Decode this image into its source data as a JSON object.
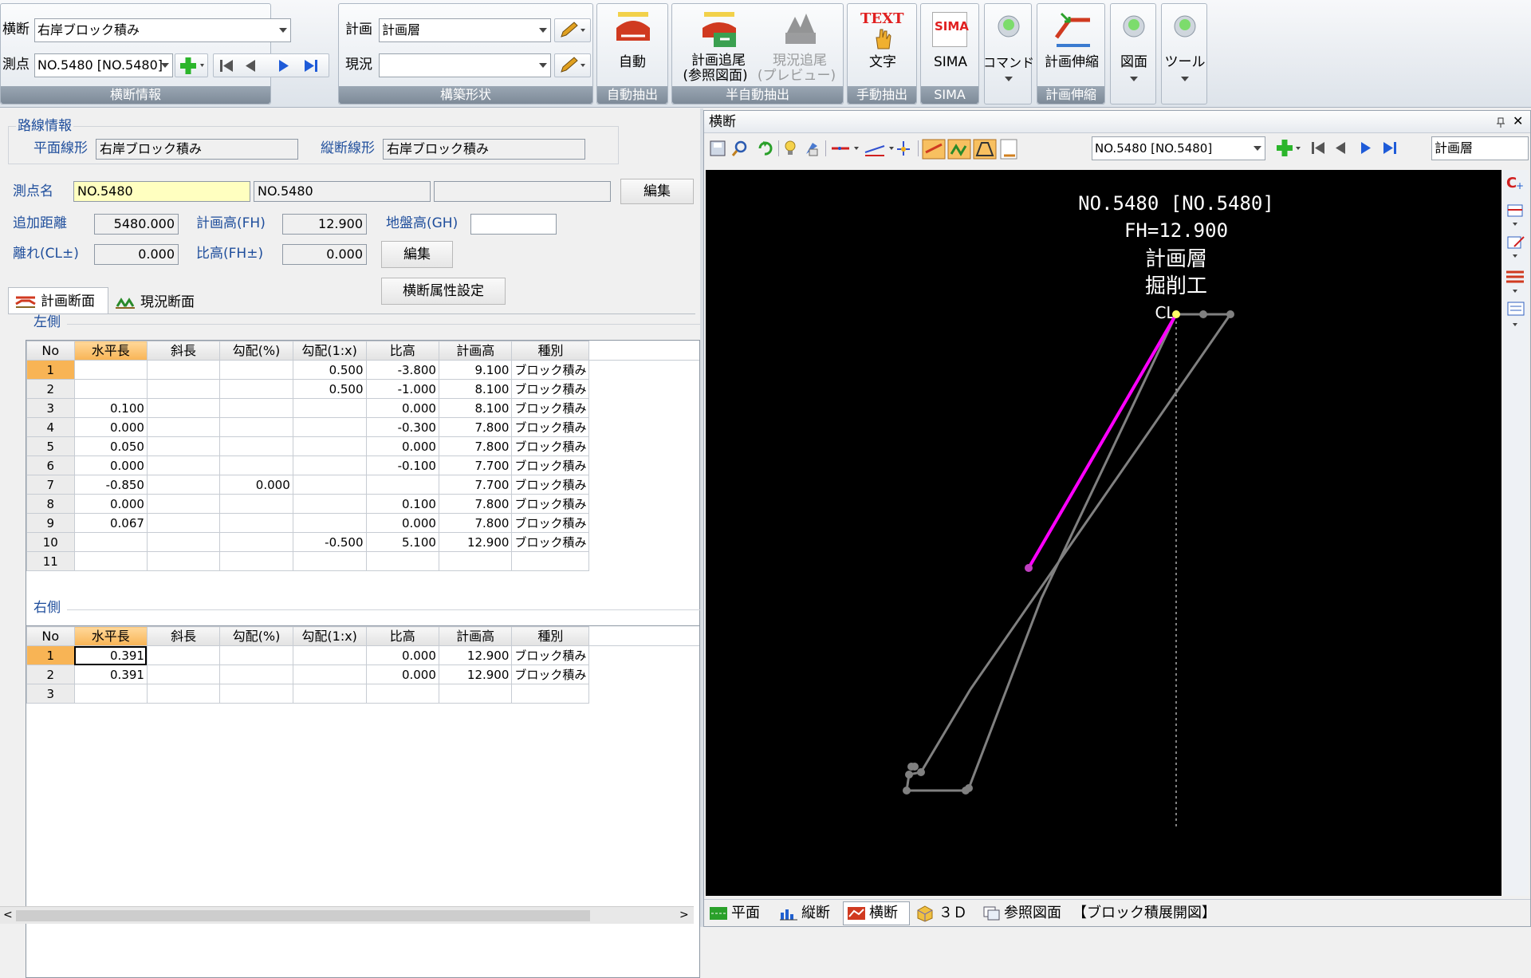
{
  "ribbon": {
    "oudan_label": "横断",
    "oudan_value": "右岸ブロック積み",
    "sokuten_label": "測点",
    "sokuten_value": "NO.5480 [NO.5480]",
    "group1_caption": "横断情報",
    "keikaku_label": "計画",
    "keikaku_value": "計画層",
    "genkyo_label": "現況",
    "genkyo_value": "",
    "group2_caption": "構築形状",
    "auto_label": "自動",
    "group3_caption": "自動抽出",
    "keikaku_tsuibi_line1": "計画追尾",
    "keikaku_tsuibi_line2": "(参照図面)",
    "genkyo_tsuibi_line1": "現況追尾",
    "genkyo_tsuibi_line2": "(プレビュー)",
    "group4_caption": "半自動抽出",
    "text_icon_word": "TEXT",
    "moji_label": "文字",
    "group5_caption": "手動抽出",
    "sima_icon_word": "SIMA",
    "sima_label": "SIMA",
    "group6_caption": "SIMA",
    "command_label": "コマンド",
    "keikaku_shinshuku_label": "計画伸縮",
    "group7_caption": "計画伸縮",
    "zumen_label": "図面",
    "tool_label": "ツール"
  },
  "left": {
    "rosen_title": "路線情報",
    "heimen_label": "平面線形",
    "heimen_value": "右岸ブロック積み",
    "jyudan_label": "縦断線形",
    "jyudan_value": "右岸ブロック積み",
    "sokuten_name_label": "測点名",
    "sokuten_name_value": "NO.5480",
    "sokuten_name_value2": "NO.5480",
    "sokuten_name_value3": "",
    "edit_label": "編集",
    "tsuika_label": "追加距離",
    "tsuika_value": "5480.000",
    "keikakudaka_label": "計画高(FH)",
    "keikakudaka_value": "12.900",
    "jibandaka_label": "地盤高(GH)",
    "jibandaka_value": "",
    "hanare_label": "離れ(CL±)",
    "hanare_value": "0.000",
    "hikou_label": "比高(FH±)",
    "hikou_value": "0.000",
    "edit2_label": "編集",
    "zokusei_label": "横断属性設定",
    "tab_keikaku": "計画断面",
    "tab_genkyo": "現況断面",
    "left_side_title": "左側",
    "right_side_title": "右側",
    "columns": [
      "No",
      "水平長",
      "斜長",
      "勾配(%)",
      "勾配(1:x)",
      "比高",
      "計画高",
      "種別"
    ],
    "left_rows": [
      {
        "no": "1",
        "h": "",
        "s": "",
        "p": "",
        "x": "0.500",
        "hk": "-3.800",
        "fh": "9.100",
        "type": "ブロック積み"
      },
      {
        "no": "2",
        "h": "",
        "s": "",
        "p": "",
        "x": "0.500",
        "hk": "-1.000",
        "fh": "8.100",
        "type": "ブロック積み"
      },
      {
        "no": "3",
        "h": "0.100",
        "s": "",
        "p": "",
        "x": "",
        "hk": "0.000",
        "fh": "8.100",
        "type": "ブロック積み"
      },
      {
        "no": "4",
        "h": "0.000",
        "s": "",
        "p": "",
        "x": "",
        "hk": "-0.300",
        "fh": "7.800",
        "type": "ブロック積み"
      },
      {
        "no": "5",
        "h": "0.050",
        "s": "",
        "p": "",
        "x": "",
        "hk": "0.000",
        "fh": "7.800",
        "type": "ブロック積み"
      },
      {
        "no": "6",
        "h": "0.000",
        "s": "",
        "p": "",
        "x": "",
        "hk": "-0.100",
        "fh": "7.700",
        "type": "ブロック積み"
      },
      {
        "no": "7",
        "h": "-0.850",
        "s": "",
        "p": "0.000",
        "x": "",
        "hk": "",
        "fh": "7.700",
        "type": "ブロック積み"
      },
      {
        "no": "8",
        "h": "0.000",
        "s": "",
        "p": "",
        "x": "",
        "hk": "0.100",
        "fh": "7.800",
        "type": "ブロック積み"
      },
      {
        "no": "9",
        "h": "0.067",
        "s": "",
        "p": "",
        "x": "",
        "hk": "0.000",
        "fh": "7.800",
        "type": "ブロック積み"
      },
      {
        "no": "10",
        "h": "",
        "s": "",
        "p": "",
        "x": "-0.500",
        "hk": "5.100",
        "fh": "12.900",
        "type": "ブロック積み"
      },
      {
        "no": "11",
        "h": "",
        "s": "",
        "p": "",
        "x": "",
        "hk": "",
        "fh": "",
        "type": ""
      }
    ],
    "right_rows": [
      {
        "no": "1",
        "h": "0.391",
        "s": "",
        "p": "",
        "x": "",
        "hk": "0.000",
        "fh": "12.900",
        "type": "ブロック積み"
      },
      {
        "no": "2",
        "h": "0.391",
        "s": "",
        "p": "",
        "x": "",
        "hk": "0.000",
        "fh": "12.900",
        "type": "ブロック積み"
      },
      {
        "no": "3",
        "h": "",
        "s": "",
        "p": "",
        "x": "",
        "hk": "",
        "fh": "",
        "type": ""
      }
    ]
  },
  "right": {
    "panel_title": "横断",
    "pin_glyph": "ᵖ",
    "close_glyph": "✕",
    "toolbar_station": "NO.5480 [NO.5480]",
    "toolbar_layer": "計画層",
    "canvas_line1": "NO.5480 [NO.5480]",
    "canvas_line2": "FH=12.900",
    "canvas_line3": "計画層",
    "canvas_line4": "掘削工",
    "canvas_cl": "CL",
    "profile_color": "#ff00ff",
    "outline_color": "#808080"
  },
  "statusbar": {
    "heimen": "平面",
    "jyudan": "縦断",
    "oudan": "横断",
    "threed": "３Ｄ",
    "sansho": "参照図面",
    "sansho_name": "【ブロック積展開図】"
  }
}
